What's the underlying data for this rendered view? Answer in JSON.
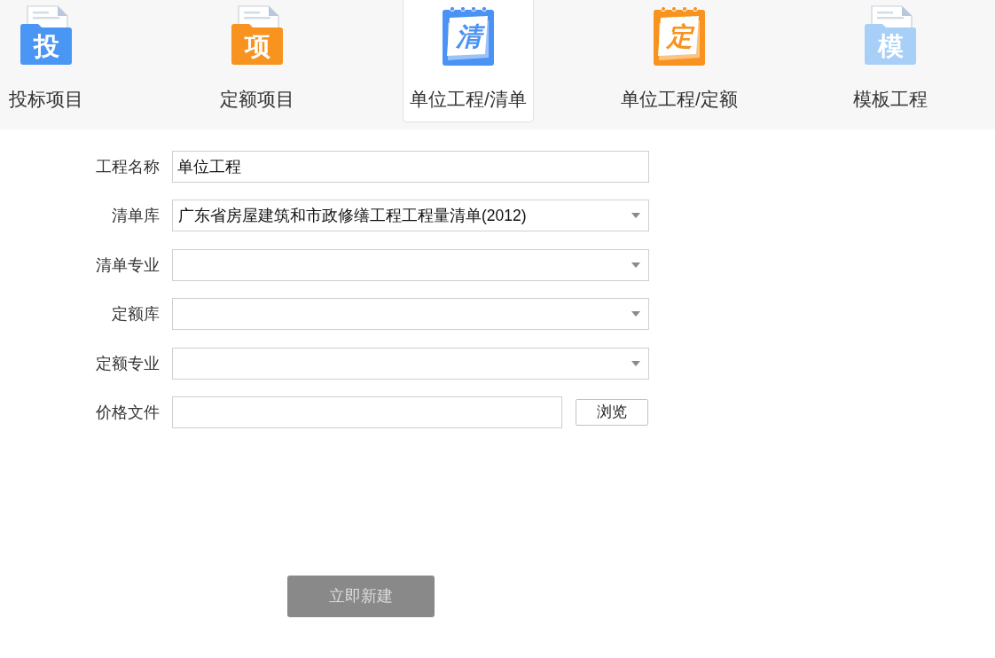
{
  "tabs": [
    {
      "label": "投标项目",
      "selected": false,
      "icon": {
        "kind": "folder",
        "glyph": "投",
        "color": "#4a96f5"
      }
    },
    {
      "label": "定额项目",
      "selected": false,
      "icon": {
        "kind": "folder",
        "glyph": "项",
        "color": "#f8931f"
      }
    },
    {
      "label": "单位工程/清单",
      "selected": true,
      "icon": {
        "kind": "notepad",
        "glyph": "清",
        "color": "#4a92f3"
      }
    },
    {
      "label": "单位工程/定额",
      "selected": false,
      "icon": {
        "kind": "notepad",
        "glyph": "定",
        "color": "#f8931f"
      }
    },
    {
      "label": "模板工程",
      "selected": false,
      "icon": {
        "kind": "folder",
        "glyph": "模",
        "color": "#a8cff7"
      }
    }
  ],
  "form": {
    "fields": [
      {
        "kind": "text",
        "label": "工程名称",
        "value": "单位工程"
      },
      {
        "kind": "select",
        "label": "清单库",
        "value": "广东省房屋建筑和市政修缮工程工程量清单(2012)"
      },
      {
        "kind": "select",
        "label": "清单专业"
      },
      {
        "kind": "select",
        "label": "定额库"
      },
      {
        "kind": "select",
        "label": "定额专业"
      },
      {
        "kind": "file",
        "label": "价格文件",
        "button": "浏览"
      }
    ]
  },
  "submit": {
    "label": "立即新建",
    "disabled": true
  }
}
